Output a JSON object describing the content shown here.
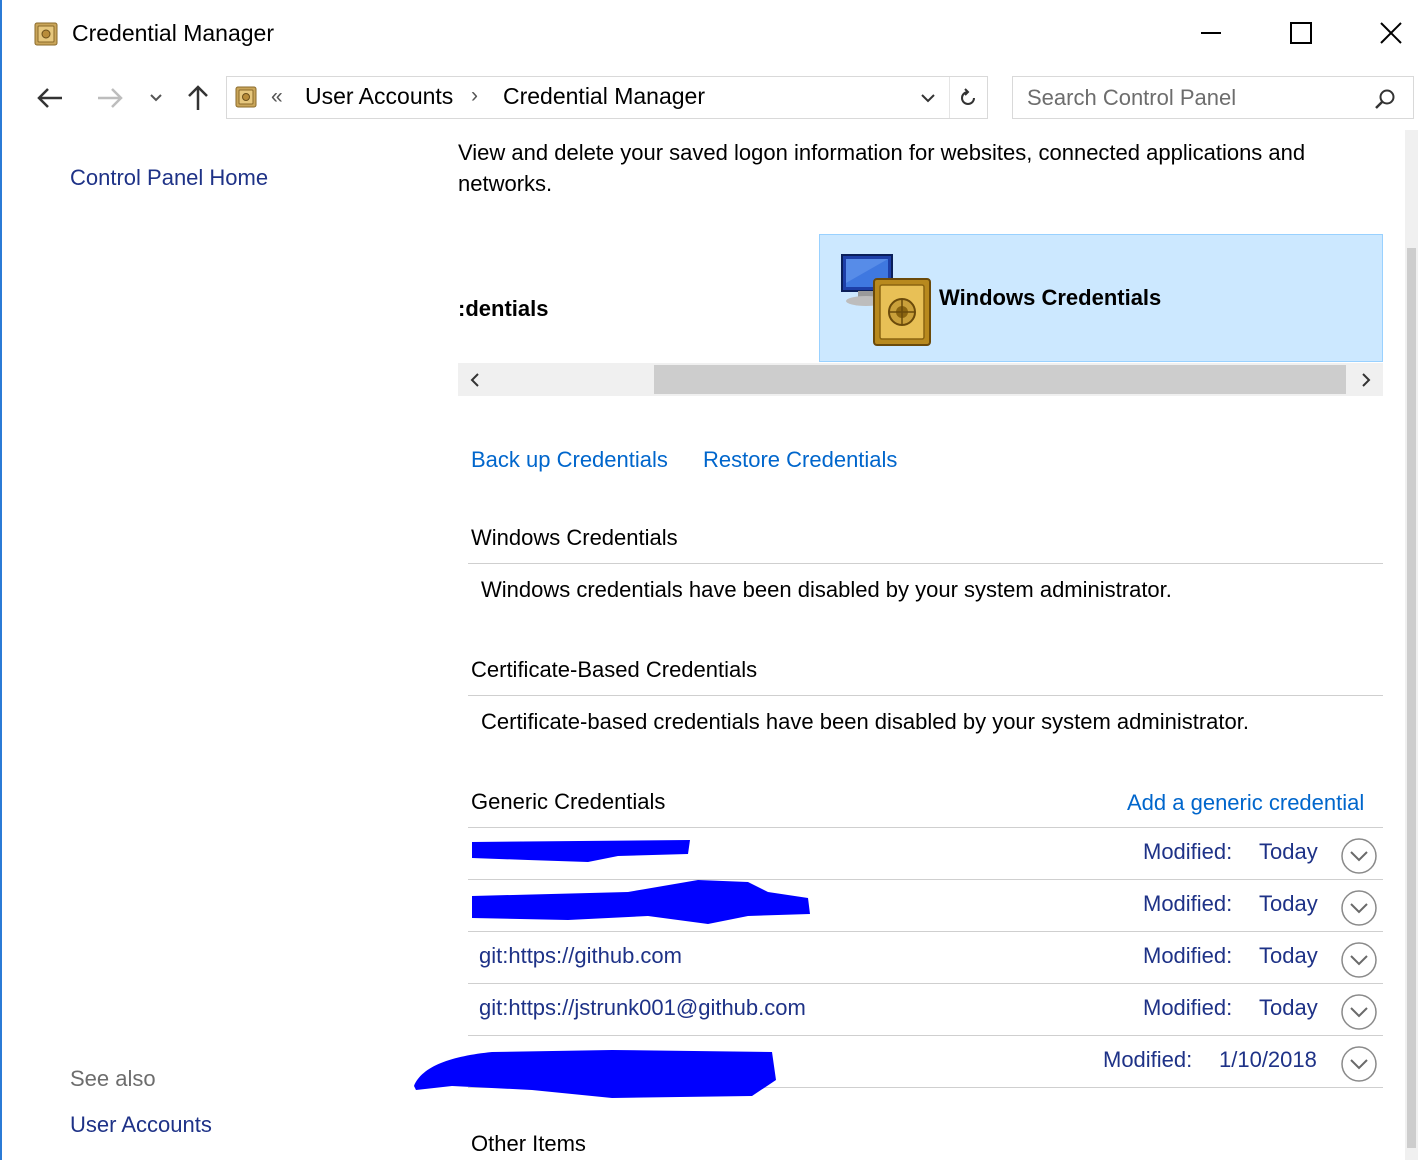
{
  "window": {
    "title": "Credential Manager",
    "controls": {
      "minimize_icon": "minimize-icon",
      "maximize_icon": "maximize-icon",
      "close_icon": "close-icon"
    }
  },
  "navigation": {
    "breadcrumb_overflow": "«",
    "breadcrumb": [
      "User Accounts",
      "Credential Manager"
    ],
    "breadcrumb_separator": "›",
    "search_placeholder": "Search Control Panel"
  },
  "left_pane": {
    "home_link": "Control Panel Home",
    "see_also_label": "See also",
    "see_also_links": [
      "User Accounts"
    ]
  },
  "main": {
    "intro": "View and delete your saved logon information for websites, connected applications and networks.",
    "selector": {
      "web_tile_label": ":dentials",
      "windows_tile_label": "Windows Credentials",
      "selected": "Windows Credentials"
    },
    "actions": {
      "backup": "Back up Credentials",
      "restore": "Restore Credentials"
    },
    "sections": {
      "windows": {
        "title": "Windows Credentials",
        "message": "Windows credentials have been disabled by your system administrator."
      },
      "certificate": {
        "title": "Certificate-Based Credentials",
        "message": "Certificate-based credentials have been disabled by your system administrator."
      },
      "generic": {
        "title": "Generic Credentials",
        "add_link": "Add a generic credential",
        "modified_label": "Modified:",
        "items": [
          {
            "name": "",
            "modified": "Today",
            "redacted": true
          },
          {
            "name": "",
            "modified": "Today",
            "redacted": true
          },
          {
            "name": "git:https://github.com",
            "modified": "Today",
            "redacted": false
          },
          {
            "name": "git:https://jstrunk001@github.com",
            "modified": "Today",
            "redacted": false
          },
          {
            "name": "",
            "modified": "1/10/2018",
            "redacted": true
          }
        ]
      },
      "other": {
        "title": "Other Items"
      }
    }
  },
  "colors": {
    "link": "#0066cc",
    "nav_link": "#1e3287",
    "selected_tile": "#cce8ff",
    "redaction": "#0000ff"
  }
}
